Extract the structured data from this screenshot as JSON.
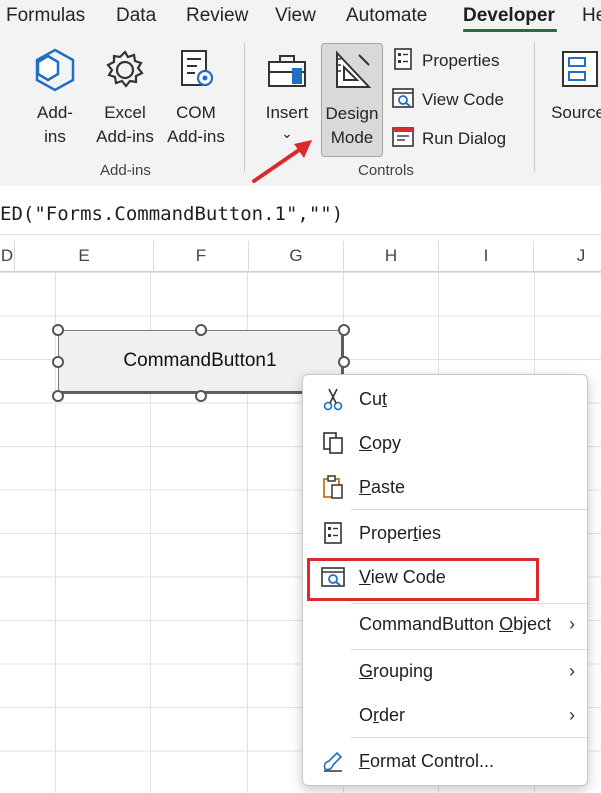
{
  "tabs": [
    {
      "label": "Formulas",
      "active": false
    },
    {
      "label": "Data",
      "active": false
    },
    {
      "label": "Review",
      "active": false
    },
    {
      "label": "View",
      "active": false
    },
    {
      "label": "Automate",
      "active": false
    },
    {
      "label": "Developer",
      "active": true
    },
    {
      "label": "He",
      "active": false
    }
  ],
  "ribbon": {
    "addins_group": {
      "label": "Add-ins",
      "buttons": [
        {
          "line1": "Add-",
          "line2": "ins",
          "icon": "addins-hexagon-icon"
        },
        {
          "line1": "Excel",
          "line2": "Add-ins",
          "icon": "gear-icon"
        },
        {
          "line1": "COM",
          "line2": "Add-ins",
          "icon": "com-addins-icon"
        }
      ]
    },
    "controls_group": {
      "label": "Controls",
      "insert": {
        "line1": "Insert",
        "line2": "⌄",
        "icon": "toolbox-icon"
      },
      "design_mode": {
        "line1": "Design",
        "line2": "Mode",
        "icon": "design-mode-icon",
        "pressed": true
      },
      "small": [
        {
          "label": "Properties",
          "icon": "properties-icon"
        },
        {
          "label": "View Code",
          "icon": "view-code-icon"
        },
        {
          "label": "Run Dialog",
          "icon": "run-dialog-icon"
        }
      ]
    },
    "xml_group": {
      "source": {
        "label": "Source",
        "icon": "xml-source-icon"
      }
    }
  },
  "formula_bar": {
    "text": "ED(\"Forms.CommandButton.1\",\"\")"
  },
  "columns": [
    "D",
    "E",
    "F",
    "G",
    "H",
    "I",
    "J"
  ],
  "command_button": {
    "label": "CommandButton1",
    "selected": true
  },
  "context_menu": {
    "items": [
      {
        "pre": "Cu",
        "ul": "t",
        "post": "",
        "icon": "scissors-icon",
        "submenu": false
      },
      {
        "pre": "",
        "ul": "C",
        "post": "opy",
        "icon": "copy-icon",
        "submenu": false
      },
      {
        "pre": "",
        "ul": "P",
        "post": "aste",
        "icon": "paste-icon",
        "submenu": false
      },
      {
        "pre": "Proper",
        "ul": "t",
        "post": "ies",
        "icon": "properties-icon",
        "submenu": false
      },
      {
        "pre": "",
        "ul": "V",
        "post": "iew Code",
        "icon": "view-code-icon",
        "submenu": false,
        "highlighted": true
      },
      {
        "pre": "CommandButton ",
        "ul": "O",
        "post": "bject",
        "icon": "",
        "submenu": true
      },
      {
        "pre": "",
        "ul": "G",
        "post": "rouping",
        "icon": "",
        "submenu": true
      },
      {
        "pre": "O",
        "ul": "r",
        "post": "der",
        "icon": "",
        "submenu": true
      },
      {
        "pre": "",
        "ul": "F",
        "post": "ormat Control...",
        "icon": "format-control-icon",
        "submenu": false
      }
    ],
    "chevron": "›"
  },
  "colors": {
    "accent_green": "#1e7145",
    "annotation_red": "#d92b2b",
    "pressed_bg": "#d9d9d9"
  }
}
